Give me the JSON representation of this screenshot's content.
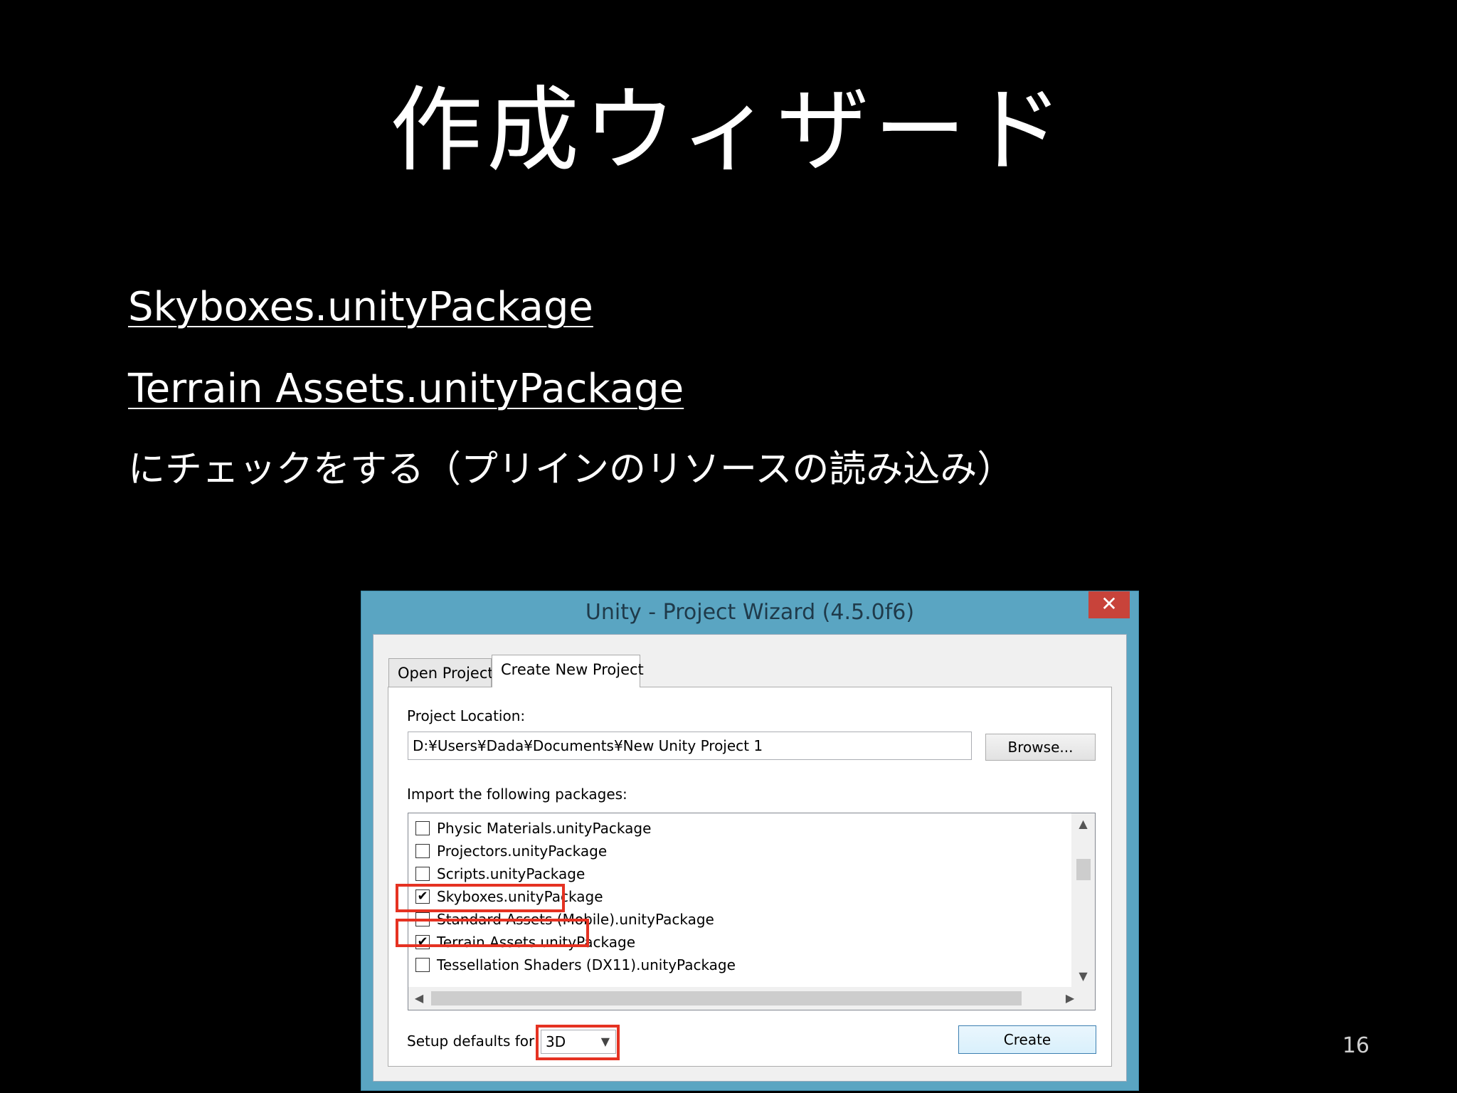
{
  "slide": {
    "title": "作成ウィザード",
    "bullets": [
      "Skyboxes.unityPackage",
      "Terrain Assets.unityPackage",
      "にチェックをする（プリインのリソースの読み込み）"
    ],
    "page_number": "16"
  },
  "window": {
    "title": "Unity - Project Wizard (4.5.0f6)",
    "close_glyph": "✕",
    "tabs": [
      {
        "label": "Open Project",
        "selected": false
      },
      {
        "label": "Create New Project",
        "selected": true
      }
    ],
    "location_label": "Project Location:",
    "location_value": "D:¥Users¥Dada¥Documents¥New Unity Project 1",
    "browse_label": "Browse...",
    "import_label": "Import the following packages:",
    "packages": [
      {
        "label": "Physic Materials.unityPackage",
        "checked": false
      },
      {
        "label": "Projectors.unityPackage",
        "checked": false
      },
      {
        "label": "Scripts.unityPackage",
        "checked": false
      },
      {
        "label": "Skyboxes.unityPackage",
        "checked": true
      },
      {
        "label": "Standard Assets (Mobile).unityPackage",
        "checked": false
      },
      {
        "label": "Terrain Assets.unityPackage",
        "checked": true
      },
      {
        "label": "Tessellation Shaders (DX11).unityPackage",
        "checked": false
      }
    ],
    "defaults_label": "Setup defaults for:",
    "defaults_value": "3D",
    "create_label": "Create",
    "highlight_color": "#e53222",
    "frame_color": "#5aa5c2"
  }
}
